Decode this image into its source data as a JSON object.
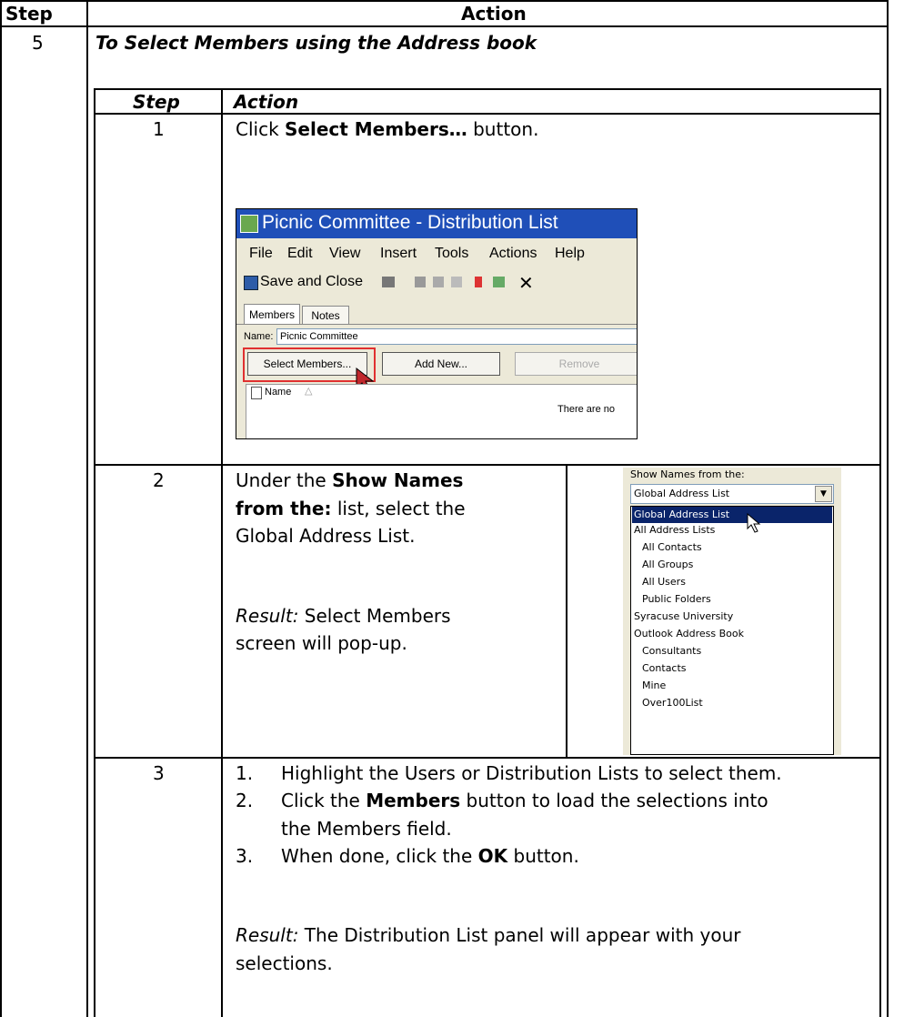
{
  "header": {
    "step": "Step",
    "action": "Action"
  },
  "outer": {
    "step_no": "5",
    "title": "To Select Members using the Address book"
  },
  "inner_header": {
    "step": "Step",
    "action": "Action"
  },
  "step1": {
    "no": "1",
    "pre": "Click ",
    "bold": "Select Members…",
    "post": " button.",
    "screenshot": {
      "title": "Picnic Committee - Distribution List",
      "menu": [
        "File",
        "Edit",
        "View",
        "Insert",
        "Tools",
        "Actions",
        "Help"
      ],
      "toolbar_save": "Save and Close",
      "tabs": [
        "Members",
        "Notes"
      ],
      "name_label": "Name:",
      "name_value": "Picnic Committee",
      "buttons": [
        "Select Members...",
        "Add New...",
        "Remove"
      ],
      "column_header": "Name",
      "empty_text": "There are no"
    }
  },
  "step2": {
    "no": "2",
    "line1_pre": "Under the ",
    "line1_bold": "Show Names",
    "line2_bold": "from the:",
    "line2_post": " list, select the",
    "line3": "Global Address List.",
    "result_label": "Result:",
    "result_line1": " Select Members",
    "result_line2": "screen will pop-up.",
    "screenshot": {
      "label": "Show Names from the:",
      "selected": "Global Address List",
      "options": [
        "Global Address List",
        "All Address Lists",
        "All Contacts",
        "All Groups",
        "All Users",
        "Public Folders",
        "Syracuse University",
        "Outlook Address Book",
        "Consultants",
        "Contacts",
        "Mine",
        "Over100List"
      ]
    }
  },
  "step3": {
    "no": "3",
    "item1_num": "1.",
    "item1": "Highlight the Users or Distribution Lists to select them.",
    "item2_num": "2.",
    "item2_pre": "Click the ",
    "item2_bold": "Members",
    "item2_post": " button to load the selections into",
    "item2_line2": "the Members field.",
    "item3_num": "3.",
    "item3_pre": "When done, click the ",
    "item3_bold": "OK",
    "item3_post": " button.",
    "result_label": "Result:",
    "result_line1": " The Distribution List panel will appear with your",
    "result_line2": "selections."
  },
  "colors": {
    "titlebar": "#1f4fb8",
    "highlight": "#0a246a",
    "callout": "#e03030",
    "cursor": "#c0282d"
  }
}
